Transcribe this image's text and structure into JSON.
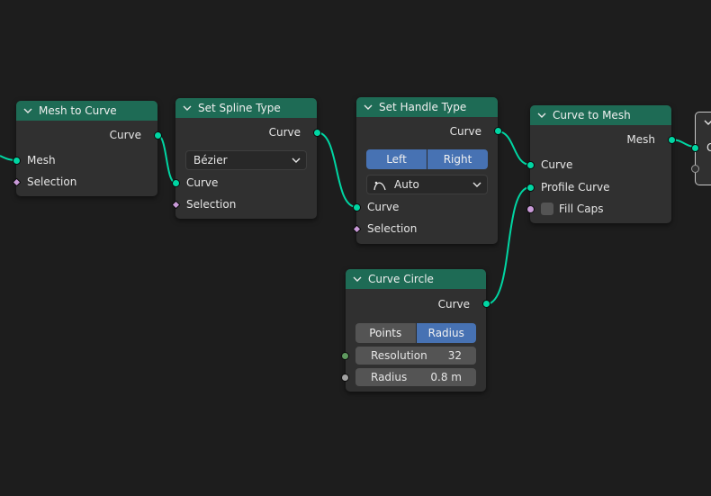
{
  "nodes": {
    "mesh_to_curve": {
      "title": "Mesh to Curve",
      "output": "Curve",
      "inputs": [
        "Mesh",
        "Selection"
      ]
    },
    "set_spline_type": {
      "title": "Set Spline Type",
      "output": "Curve",
      "spline_type": "Bézier",
      "inputs": [
        "Curve",
        "Selection"
      ]
    },
    "set_handle_type": {
      "title": "Set Handle Type",
      "output": "Curve",
      "side_options": [
        "Left",
        "Right"
      ],
      "handle_type": "Auto",
      "inputs": [
        "Curve",
        "Selection"
      ]
    },
    "curve_to_mesh": {
      "title": "Curve to Mesh",
      "output": "Mesh",
      "inputs": [
        "Curve",
        "Profile Curve",
        "Fill Caps"
      ]
    },
    "curve_circle": {
      "title": "Curve Circle",
      "output": "Curve",
      "mode_options": [
        "Points",
        "Radius"
      ],
      "mode_selected": "Radius",
      "resolution_label": "Resolution",
      "resolution_value": "32",
      "radius_label": "Radius",
      "radius_value": "0.8 m"
    },
    "partial_node": {
      "visible_text": "G"
    }
  },
  "colors": {
    "canvas": "#1d1d1d",
    "node_body": "#303030",
    "geometry_header": "#1e6b55",
    "geometry_socket": "#00d6a3",
    "field_socket": "#c99ad8",
    "int_socket": "#5f9a5f",
    "float_socket": "#a1a1a1",
    "selected_button": "#4772b3"
  }
}
